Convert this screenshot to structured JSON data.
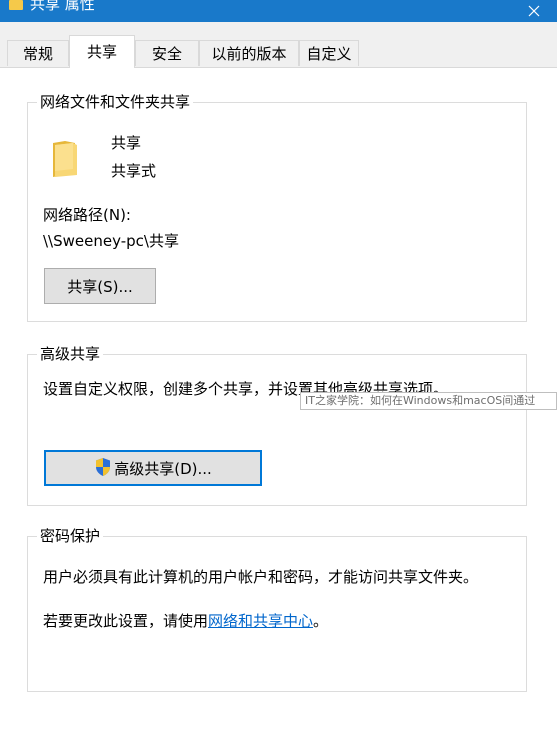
{
  "window": {
    "title": "共享 属性",
    "close_glyph": "✕"
  },
  "tabs": [
    {
      "label": "常规",
      "active": false
    },
    {
      "label": "共享",
      "active": true
    },
    {
      "label": "安全",
      "active": false
    },
    {
      "label": "以前的版本",
      "active": false
    },
    {
      "label": "自定义",
      "active": false
    }
  ],
  "network_share": {
    "group_title": "网络文件和文件夹共享",
    "folder_name": "共享",
    "share_status": "共享式",
    "path_label": "网络路径(N):",
    "path_value": "\\\\Sweeney-pc\\共享",
    "share_button": "共享(S)..."
  },
  "advanced_share": {
    "group_title": "高级共享",
    "description": "设置自定义权限，创建多个共享，并设置其他高级共享选项。",
    "button": "高级共享(D)..."
  },
  "password": {
    "group_title": "密码保护",
    "description": "用户必须具有此计算机的用户帐户和密码，才能访问共享文件夹。",
    "change_prefix": "若要更改此设置，请使用",
    "change_link": "网络和共享中心",
    "change_suffix": "。"
  },
  "tooltip": {
    "text": "IT之家学院：如何在Windows和macOS间通过"
  },
  "colors": {
    "title_bar": "#1979ca",
    "link": "#0066cc",
    "default_button_border": "#0078d7",
    "folder": "#f5c94a"
  }
}
